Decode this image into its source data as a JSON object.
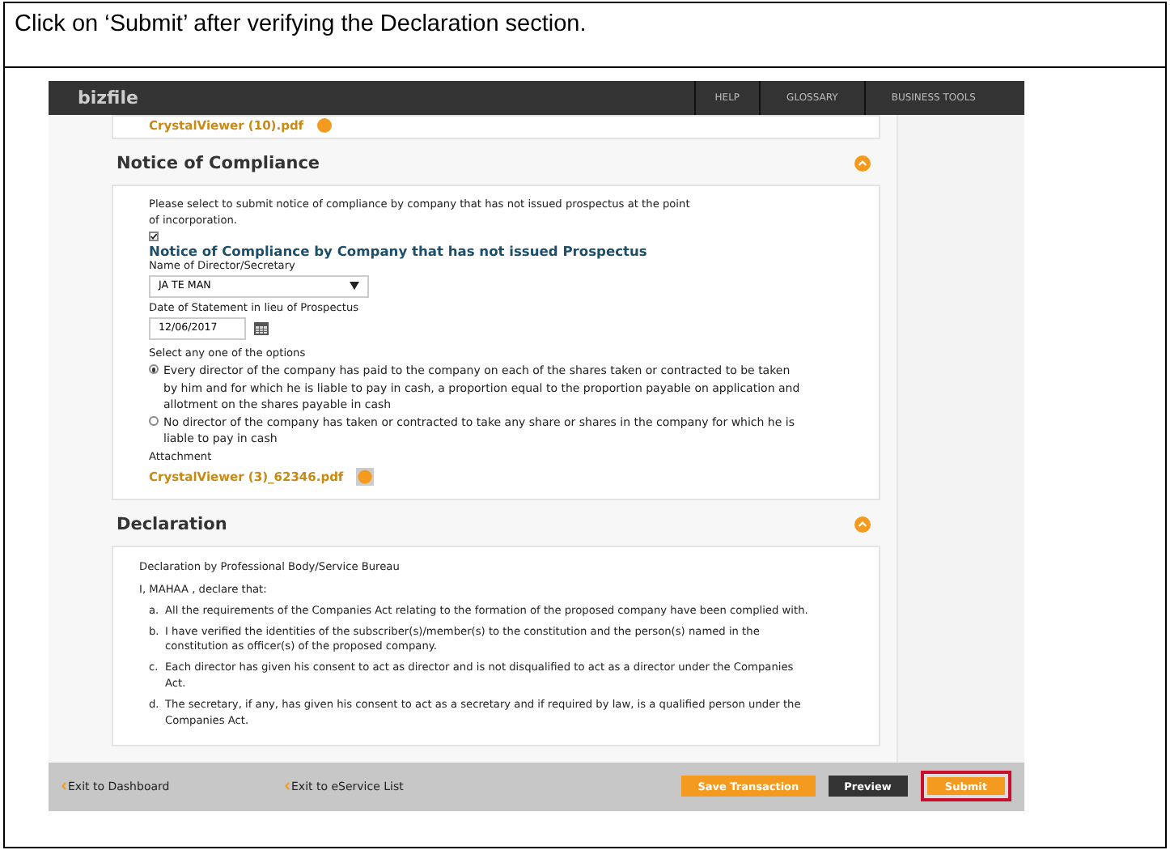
{
  "instruction": "Click on ‘Submit’ after verifying the Declaration section.",
  "app": {
    "logo": "bizfile",
    "nav": [
      {
        "label": "HELP"
      },
      {
        "label": "GLOSSARY"
      },
      {
        "label": "BUSINESS TOOLS"
      }
    ]
  },
  "previous_attachment": "CrystalViewer (10).pdf",
  "notice": {
    "title": "Notice of Compliance",
    "expanded": true,
    "intro": "Please select to submit notice of compliance by company that has not issued prospectus at the point of incorporation.",
    "checked": true,
    "subtitle": "Notice of Compliance by Company that has not issued Prospectus",
    "director_label": "Name of Director/Secretary",
    "director_value": "JA TE MAN",
    "date_label": "Date of Statement in lieu of Prospectus",
    "date_value": "12/06/2017",
    "options_label": "Select any one of the options",
    "options": [
      {
        "label": "Every director of the company has paid to the company on each of the shares taken or contracted to be taken by him and for which he is liable to pay in cash, a proportion equal to the proportion payable on application and allotment on the shares payable in cash",
        "selected": true
      },
      {
        "label": "No director of the company has taken or contracted to take any share or shares in the company for which he is liable to pay in cash",
        "selected": false
      }
    ],
    "attachment_label": "Attachment",
    "attachment": "CrystalViewer (3)_62346.pdf"
  },
  "declaration": {
    "title": "Declaration",
    "expanded": true,
    "by": "Declaration by Professional Body/Service Bureau",
    "intro": "I, MAHAA , declare that:",
    "items": [
      {
        "marker": "a.",
        "text": "All the requirements of the Companies Act relating to the formation of the proposed company have been complied with."
      },
      {
        "marker": "b.",
        "text": "I have verified the identities of the subscriber(s)/member(s) to the constitution and the person(s) named in the constitution as officer(s) of the proposed company."
      },
      {
        "marker": "c.",
        "text": "Each director has given his consent to act as director and is not disqualified to act as a director under the Companies Act."
      },
      {
        "marker": "d.",
        "text": "The secretary, if any, has given his consent to act as a secretary and if required by law, is a qualified person under the Companies Act."
      }
    ]
  },
  "footer": {
    "links": [
      {
        "label": "Exit to Dashboard"
      },
      {
        "label": "Exit to eService List"
      }
    ],
    "buttons": [
      {
        "label": "Save Transaction",
        "kind": "save",
        "highlighted": false
      },
      {
        "label": "Preview",
        "kind": "preview",
        "highlighted": false
      },
      {
        "label": "Submit",
        "kind": "submit",
        "highlighted": true
      }
    ]
  }
}
